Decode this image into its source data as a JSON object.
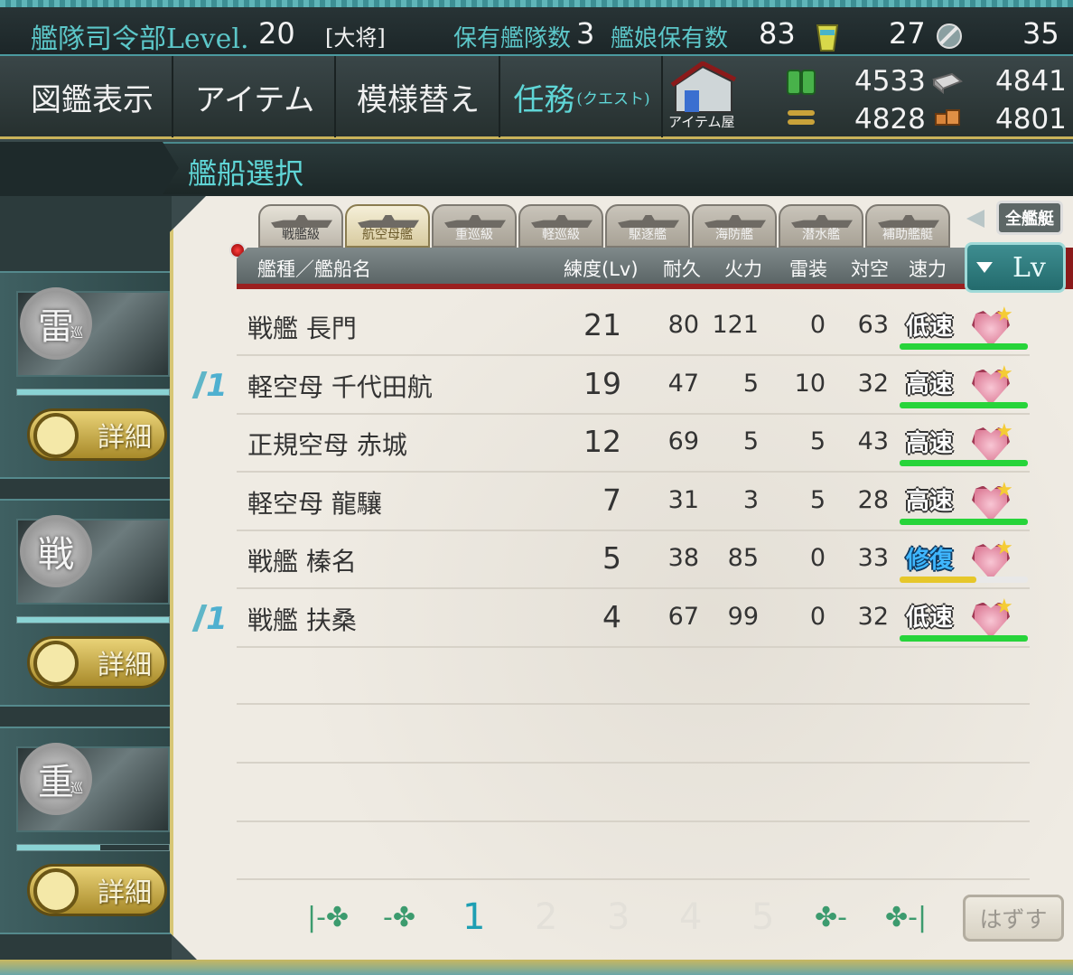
{
  "topbar": {
    "hq_label": "艦隊司令部Level.",
    "hq_level": "20",
    "rank": "[大将]",
    "fleets_label": "保有艦隊数",
    "fleets_count": "3",
    "ships_label": "艦娘保有数",
    "ships_count": "83",
    "buckets": "27",
    "dev_material": "35"
  },
  "menu": {
    "encyclopedia": "図鑑表示",
    "items": "アイテム",
    "furniture": "模様替え",
    "quest": "任務",
    "quest_small": "(クエスト)",
    "shop": "アイテム屋"
  },
  "resources": {
    "fuel": "4533",
    "steel": "4841",
    "ammo": "4828",
    "bauxite": "4801"
  },
  "header": {
    "title": "艦船選択"
  },
  "fleet_slots": [
    {
      "badge": "雷",
      "badge_small": "巡",
      "detail_label": "詳細",
      "hp_percent": 100
    },
    {
      "badge": "戦",
      "badge_small": "",
      "detail_label": "詳細",
      "hp_percent": 100
    },
    {
      "badge": "重",
      "badge_small": "巡",
      "detail_label": "詳細",
      "hp_percent": 55
    }
  ],
  "filter_tabs": [
    {
      "label": "戦艦級",
      "selected": false
    },
    {
      "label": "航空母艦",
      "selected": true
    },
    {
      "label": "重巡級",
      "selected": false
    },
    {
      "label": "軽巡級",
      "selected": false
    },
    {
      "label": "駆逐艦",
      "selected": false
    },
    {
      "label": "海防艦",
      "selected": false
    },
    {
      "label": "潜水艦",
      "selected": false
    },
    {
      "label": "補助艦艇",
      "selected": false
    }
  ],
  "all_ships_label": "全艦艇",
  "columns": {
    "name": "艦種／艦船名",
    "level": "練度(Lv)",
    "hp": "耐久",
    "firepower": "火力",
    "torpedo": "雷装",
    "aa": "対空",
    "speed": "速力"
  },
  "sort": {
    "label": "Lv"
  },
  "ships": [
    {
      "name": "戦艦 長門",
      "level": "21",
      "hp": "80",
      "firepower": "121",
      "torpedo": "0",
      "aa": "63",
      "speed": "低速",
      "repair": false,
      "fleet_flag": "",
      "cond": 100,
      "cond_color": "#27d43a"
    },
    {
      "name": "軽空母 千代田航",
      "level": "19",
      "hp": "47",
      "firepower": "5",
      "torpedo": "10",
      "aa": "32",
      "speed": "高速",
      "repair": false,
      "fleet_flag": "1",
      "cond": 100,
      "cond_color": "#27d43a"
    },
    {
      "name": "正規空母 赤城",
      "level": "12",
      "hp": "69",
      "firepower": "5",
      "torpedo": "5",
      "aa": "43",
      "speed": "高速",
      "repair": false,
      "fleet_flag": "",
      "cond": 100,
      "cond_color": "#27d43a"
    },
    {
      "name": "軽空母 龍驤",
      "level": "7",
      "hp": "31",
      "firepower": "3",
      "torpedo": "5",
      "aa": "28",
      "speed": "高速",
      "repair": false,
      "fleet_flag": "",
      "cond": 100,
      "cond_color": "#27d43a"
    },
    {
      "name": "戦艦 榛名",
      "level": "5",
      "hp": "38",
      "firepower": "85",
      "torpedo": "0",
      "aa": "33",
      "speed": "修復",
      "repair": true,
      "fleet_flag": "",
      "cond": 60,
      "cond_color": "#e6c72a"
    },
    {
      "name": "戦艦 扶桑",
      "level": "4",
      "hp": "67",
      "firepower": "99",
      "torpedo": "0",
      "aa": "32",
      "speed": "低速",
      "repair": false,
      "fleet_flag": "1",
      "cond": 100,
      "cond_color": "#27d43a"
    }
  ],
  "pager": {
    "first": "|-✤",
    "prev": "-✤",
    "pages": [
      "1",
      "2",
      "3",
      "4",
      "5"
    ],
    "current": 1,
    "next": "✤-",
    "last": "✤-|"
  },
  "release_label": "はずす"
}
